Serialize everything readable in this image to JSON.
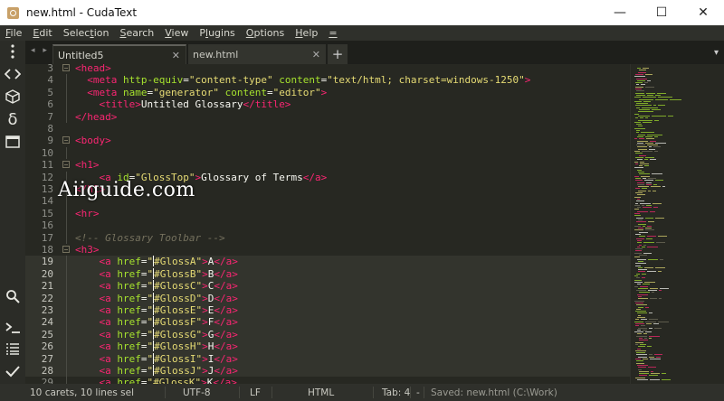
{
  "window": {
    "title": "new.html - CudaText",
    "minimize": "—",
    "maximize": "☐",
    "close": "✕"
  },
  "menu": [
    {
      "pre": "",
      "ul": "F",
      "post": "ile"
    },
    {
      "pre": "",
      "ul": "E",
      "post": "dit"
    },
    {
      "pre": "Selec",
      "ul": "t",
      "post": "ion"
    },
    {
      "pre": "",
      "ul": "S",
      "post": "earch"
    },
    {
      "pre": "",
      "ul": "V",
      "post": "iew"
    },
    {
      "pre": "P",
      "ul": "l",
      "post": "ugins"
    },
    {
      "pre": "",
      "ul": "O",
      "post": "ptions"
    },
    {
      "pre": "",
      "ul": "H",
      "post": "elp"
    },
    {
      "pre": "",
      "ul": "=",
      "post": ""
    }
  ],
  "sidebar_icons": [
    "menu-dots-icon",
    "code-icon",
    "cube-icon",
    "delta-icon",
    "panel-icon",
    "search-icon",
    "terminal-icon",
    "list-icon",
    "check-icon"
  ],
  "tabs": {
    "nav": "◂ ▸",
    "items": [
      {
        "label": "Untitled5",
        "close": "✕"
      },
      {
        "label": "new.html",
        "close": "✕"
      }
    ],
    "add": "+",
    "menu": "▾"
  },
  "editor_lines": [
    {
      "n": "3",
      "fold": "box",
      "parts": [
        [
          "t",
          "<head>"
        ]
      ]
    },
    {
      "n": "4",
      "fold": "line",
      "parts": [
        [
          "p",
          "  "
        ],
        [
          "t",
          "<meta "
        ],
        [
          "a",
          "http-equiv"
        ],
        [
          "p",
          "="
        ],
        [
          "s",
          "\"content-type\""
        ],
        [
          "p",
          " "
        ],
        [
          "a",
          "content"
        ],
        [
          "p",
          "="
        ],
        [
          "s",
          "\"text/html; charset=windows-1250\""
        ],
        [
          "t",
          ">"
        ]
      ]
    },
    {
      "n": "5",
      "fold": "line",
      "parts": [
        [
          "p",
          "  "
        ],
        [
          "t",
          "<meta "
        ],
        [
          "a",
          "name"
        ],
        [
          "p",
          "="
        ],
        [
          "s",
          "\"generator\""
        ],
        [
          "p",
          " "
        ],
        [
          "a",
          "content"
        ],
        [
          "p",
          "="
        ],
        [
          "s",
          "\"editor\""
        ],
        [
          "t",
          ">"
        ]
      ]
    },
    {
      "n": "6",
      "fold": "line",
      "parts": [
        [
          "p",
          "    "
        ],
        [
          "t",
          "<title>"
        ],
        [
          "p",
          "Untitled Glossary"
        ],
        [
          "t",
          "</title>"
        ]
      ]
    },
    {
      "n": "7",
      "fold": "line",
      "parts": [
        [
          "t",
          "</head>"
        ]
      ]
    },
    {
      "n": "8",
      "fold": "",
      "parts": []
    },
    {
      "n": "9",
      "fold": "box",
      "parts": [
        [
          "t",
          "<body>"
        ]
      ]
    },
    {
      "n": "10",
      "fold": "line",
      "parts": []
    },
    {
      "n": "11",
      "fold": "box",
      "parts": [
        [
          "t",
          "<h1>"
        ]
      ]
    },
    {
      "n": "12",
      "fold": "line",
      "parts": [
        [
          "p",
          "    "
        ],
        [
          "t",
          "<a "
        ],
        [
          "a",
          "id"
        ],
        [
          "p",
          "="
        ],
        [
          "s",
          "\"GlossTop\""
        ],
        [
          "t",
          ">"
        ],
        [
          "p",
          "Glossary of Terms"
        ],
        [
          "t",
          "</a>"
        ]
      ]
    },
    {
      "n": "13",
      "fold": "line",
      "parts": [
        [
          "t",
          "</h1>"
        ]
      ]
    },
    {
      "n": "14",
      "fold": "line",
      "parts": []
    },
    {
      "n": "15",
      "fold": "line",
      "parts": [
        [
          "t",
          "<hr>"
        ]
      ]
    },
    {
      "n": "16",
      "fold": "line",
      "parts": []
    },
    {
      "n": "17",
      "fold": "line",
      "parts": [
        [
          "c",
          "<!-- Glossary Toolbar -->"
        ]
      ]
    },
    {
      "n": "18",
      "fold": "box",
      "parts": [
        [
          "t",
          "<h3>"
        ]
      ]
    },
    {
      "n": "19",
      "fold": "line",
      "hl": true,
      "parts": [
        [
          "p",
          "    "
        ],
        [
          "t",
          "<a "
        ],
        [
          "a",
          "href"
        ],
        [
          "p",
          "="
        ],
        [
          "s",
          "\""
        ],
        [
          "caret",
          ""
        ],
        [
          "s",
          "#GlossA\""
        ],
        [
          "t",
          ">"
        ],
        [
          "p",
          "A"
        ],
        [
          "t",
          "</a>"
        ]
      ]
    },
    {
      "n": "20",
      "fold": "line",
      "hl": true,
      "parts": [
        [
          "p",
          "    "
        ],
        [
          "t",
          "<a "
        ],
        [
          "a",
          "href"
        ],
        [
          "p",
          "="
        ],
        [
          "s",
          "\""
        ],
        [
          "caret",
          ""
        ],
        [
          "s",
          "#GlossB\""
        ],
        [
          "t",
          ">"
        ],
        [
          "p",
          "B"
        ],
        [
          "t",
          "</a>"
        ]
      ]
    },
    {
      "n": "21",
      "fold": "line",
      "hl": true,
      "parts": [
        [
          "p",
          "    "
        ],
        [
          "t",
          "<a "
        ],
        [
          "a",
          "href"
        ],
        [
          "p",
          "="
        ],
        [
          "s",
          "\""
        ],
        [
          "caret",
          ""
        ],
        [
          "s",
          "#GlossC\""
        ],
        [
          "t",
          ">"
        ],
        [
          "p",
          "C"
        ],
        [
          "t",
          "</a>"
        ]
      ]
    },
    {
      "n": "22",
      "fold": "line",
      "hl": true,
      "parts": [
        [
          "p",
          "    "
        ],
        [
          "t",
          "<a "
        ],
        [
          "a",
          "href"
        ],
        [
          "p",
          "="
        ],
        [
          "s",
          "\""
        ],
        [
          "caret",
          ""
        ],
        [
          "s",
          "#GlossD\""
        ],
        [
          "t",
          ">"
        ],
        [
          "p",
          "D"
        ],
        [
          "t",
          "</a>"
        ]
      ]
    },
    {
      "n": "23",
      "fold": "line",
      "hl": true,
      "parts": [
        [
          "p",
          "    "
        ],
        [
          "t",
          "<a "
        ],
        [
          "a",
          "href"
        ],
        [
          "p",
          "="
        ],
        [
          "s",
          "\""
        ],
        [
          "caret",
          ""
        ],
        [
          "s",
          "#GlossE\""
        ],
        [
          "t",
          ">"
        ],
        [
          "p",
          "E"
        ],
        [
          "t",
          "</a>"
        ]
      ]
    },
    {
      "n": "24",
      "fold": "line",
      "hl": true,
      "parts": [
        [
          "p",
          "    "
        ],
        [
          "t",
          "<a "
        ],
        [
          "a",
          "href"
        ],
        [
          "p",
          "="
        ],
        [
          "s",
          "\""
        ],
        [
          "caret",
          ""
        ],
        [
          "s",
          "#GlossF\""
        ],
        [
          "t",
          ">"
        ],
        [
          "p",
          "F"
        ],
        [
          "t",
          "</a>"
        ]
      ]
    },
    {
      "n": "25",
      "fold": "line",
      "hl": true,
      "parts": [
        [
          "p",
          "    "
        ],
        [
          "t",
          "<a "
        ],
        [
          "a",
          "href"
        ],
        [
          "p",
          "="
        ],
        [
          "s",
          "\""
        ],
        [
          "caret",
          ""
        ],
        [
          "s",
          "#GlossG\""
        ],
        [
          "t",
          ">"
        ],
        [
          "p",
          "G"
        ],
        [
          "t",
          "</a>"
        ]
      ]
    },
    {
      "n": "26",
      "fold": "line",
      "hl": true,
      "parts": [
        [
          "p",
          "    "
        ],
        [
          "t",
          "<a "
        ],
        [
          "a",
          "href"
        ],
        [
          "p",
          "="
        ],
        [
          "s",
          "\""
        ],
        [
          "caret",
          ""
        ],
        [
          "s",
          "#GlossH\""
        ],
        [
          "t",
          ">"
        ],
        [
          "p",
          "H"
        ],
        [
          "t",
          "</a>"
        ]
      ]
    },
    {
      "n": "27",
      "fold": "line",
      "hl": true,
      "parts": [
        [
          "p",
          "    "
        ],
        [
          "t",
          "<a "
        ],
        [
          "a",
          "href"
        ],
        [
          "p",
          "="
        ],
        [
          "s",
          "\""
        ],
        [
          "caret",
          ""
        ],
        [
          "s",
          "#GlossI\""
        ],
        [
          "t",
          ">"
        ],
        [
          "p",
          "I"
        ],
        [
          "t",
          "</a>"
        ]
      ]
    },
    {
      "n": "28",
      "fold": "line",
      "hl": true,
      "parts": [
        [
          "p",
          "    "
        ],
        [
          "t",
          "<a "
        ],
        [
          "a",
          "href"
        ],
        [
          "p",
          "="
        ],
        [
          "s",
          "\""
        ],
        [
          "caret",
          ""
        ],
        [
          "s",
          "#GlossJ\""
        ],
        [
          "t",
          ">"
        ],
        [
          "p",
          "J"
        ],
        [
          "t",
          "</a>"
        ]
      ]
    },
    {
      "n": "29",
      "fold": "line",
      "parts": [
        [
          "p",
          "    "
        ],
        [
          "t",
          "<a "
        ],
        [
          "a",
          "href"
        ],
        [
          "p",
          "="
        ],
        [
          "s",
          "\"#GlossK\""
        ],
        [
          "t",
          ">"
        ],
        [
          "p",
          "K"
        ],
        [
          "t",
          "</a>"
        ]
      ]
    }
  ],
  "watermark": "Aiiguide.com",
  "statusbar": {
    "carets": "10 carets, 10 lines sel",
    "encoding": "UTF-8",
    "eol": "LF",
    "lexer": "HTML",
    "tab": "Tab: 4",
    "dash": "-",
    "message": "Saved: new.html (C:\\Work)"
  },
  "colors": {
    "background": "#272822",
    "tag": "#f92672",
    "attribute": "#a6e22e",
    "string": "#e6db74",
    "comment": "#75715e",
    "text": "#f8f8f2"
  }
}
